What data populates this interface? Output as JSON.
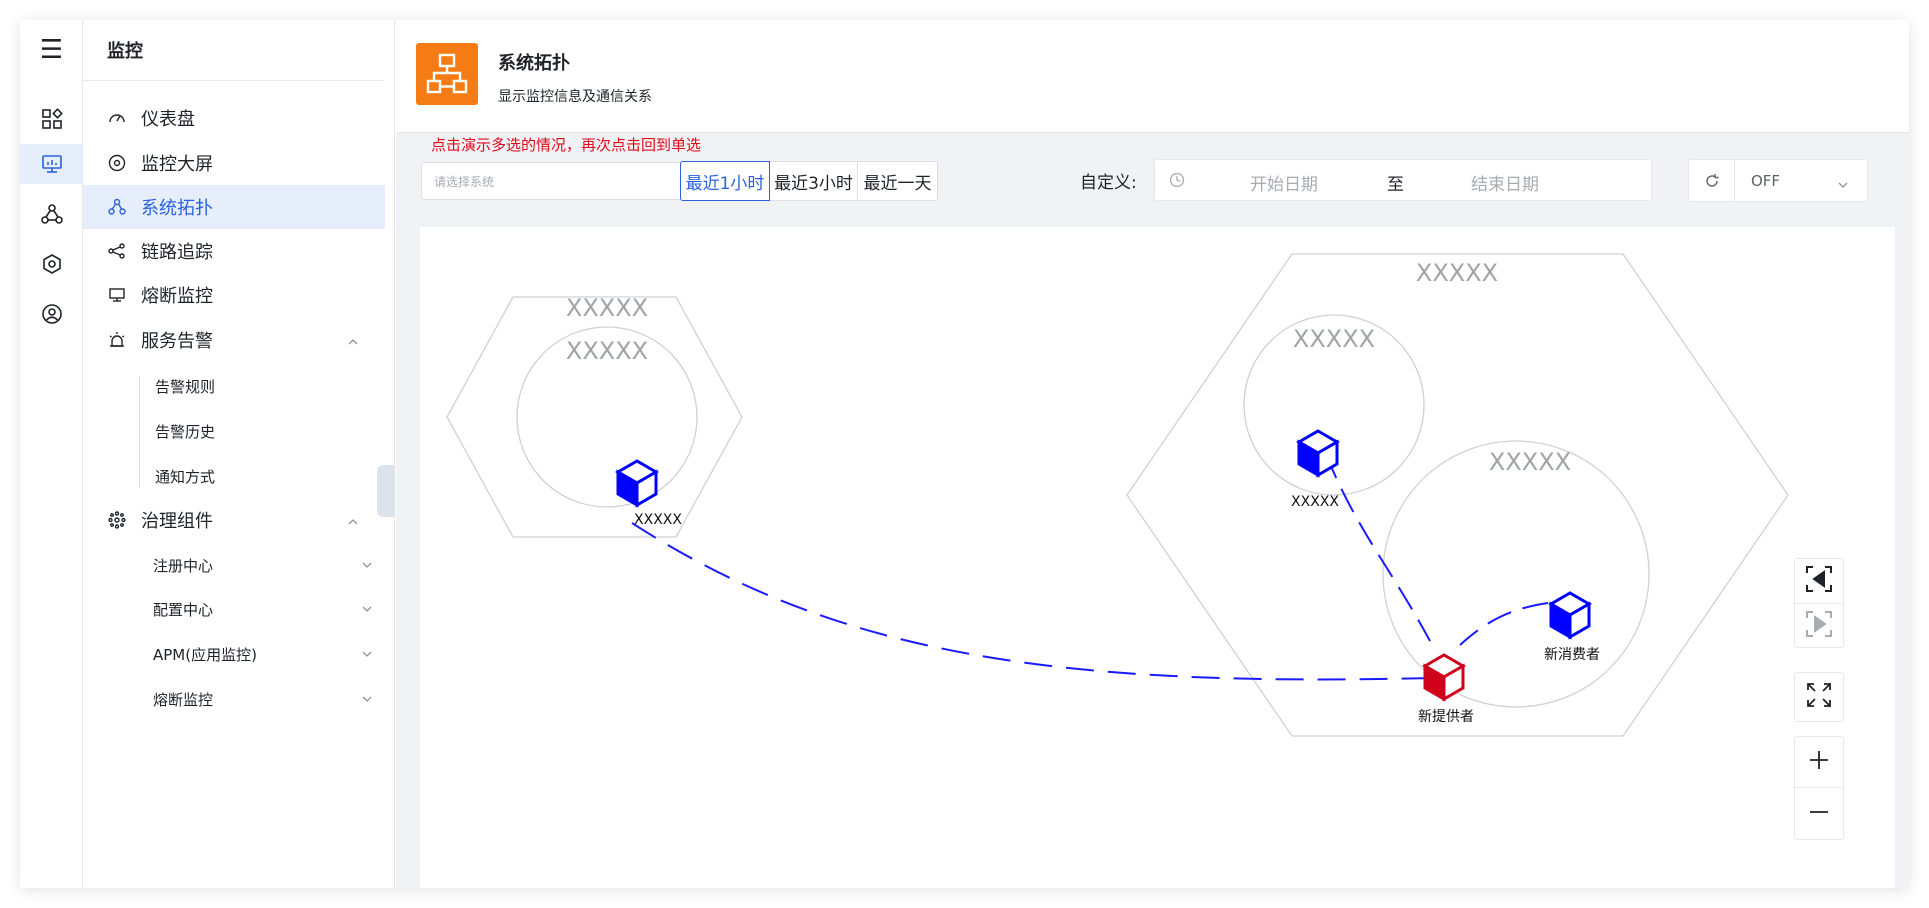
{
  "nav": {
    "header": "监控",
    "items": [
      {
        "label": "仪表盘"
      },
      {
        "label": "监控大屏"
      },
      {
        "label": "系统拓扑",
        "active": true
      },
      {
        "label": "链路追踪"
      },
      {
        "label": "熔断监控"
      },
      {
        "label": "服务告警",
        "expanded": true,
        "children": [
          "告警规则",
          "告警历史",
          "通知方式"
        ]
      },
      {
        "label": "治理组件",
        "expanded": true,
        "children": [
          "注册中心",
          "配置中心",
          "APM(应用监控)",
          "熔断监控"
        ]
      }
    ]
  },
  "page": {
    "title": "系统拓扑",
    "subtitle": "显示监控信息及通信关系"
  },
  "toolbar": {
    "hint": "点击演示多选的情况，再次点击回到单选",
    "system_select": {
      "placeholder": "请选择系统"
    },
    "time_ranges": [
      "最近1小时",
      "最近3小时",
      "最近一天"
    ],
    "active_time_range": "最近1小时",
    "custom_label": "自定义:",
    "start_placeholder": "开始日期",
    "range_separator": "至",
    "end_placeholder": "结束日期",
    "refresh_value": "OFF"
  },
  "topology": {
    "groups": [
      {
        "label": "XXXXX",
        "shape": "hexagon"
      },
      {
        "label": "XXXXX",
        "shape": "circle"
      },
      {
        "label": "XXXXX",
        "shape": "hexagon"
      },
      {
        "label": "XXXXX",
        "shape": "circle"
      },
      {
        "label": "XXXXX",
        "shape": "circle"
      }
    ],
    "nodes": [
      {
        "label": "XXXXX",
        "color": "#0000ff"
      },
      {
        "label": "XXXXX",
        "color": "#0000ff"
      },
      {
        "label": "新提供者",
        "color": "#d0021b"
      },
      {
        "label": "新消费者",
        "color": "#0000ff"
      }
    ],
    "edge_color": "#1a1aff"
  },
  "colors": {
    "accent": "#2c61e0",
    "brand_logo": "#f57c14",
    "hint_red": "#e0091a"
  }
}
